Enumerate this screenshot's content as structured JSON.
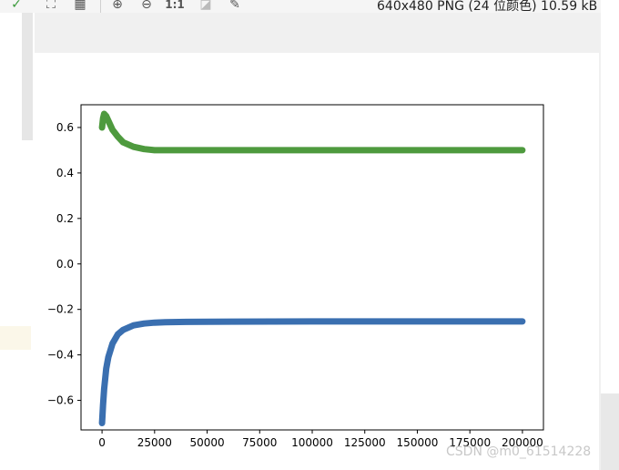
{
  "toolbar": {
    "icons": [
      "check-icon",
      "fit-icon",
      "grid-icon",
      "zoom-in-icon",
      "zoom-out-icon",
      "actual-size-icon",
      "crop-icon",
      "eyedropper-icon"
    ],
    "actual_size_label": "1:1",
    "file_info": "640x480 PNG (24 位颜色) 10.59 kB"
  },
  "watermark": "CSDN @m0_61514228",
  "chart_data": {
    "type": "line",
    "title": "",
    "xlabel": "",
    "ylabel": "",
    "xlim": [
      -10000,
      210000
    ],
    "ylim": [
      -0.73,
      0.7
    ],
    "x_ticks": [
      0,
      25000,
      50000,
      75000,
      100000,
      125000,
      150000,
      175000,
      200000
    ],
    "x_tick_labels": [
      "0",
      "25000",
      "50000",
      "75000",
      "100000",
      "125000",
      "150000",
      "175000",
      "200000"
    ],
    "y_ticks": [
      0.6,
      0.4,
      0.2,
      0.0,
      -0.2,
      -0.4,
      -0.6
    ],
    "y_tick_labels": [
      "0.6",
      "0.4",
      "0.2",
      "0.0",
      "−0.2",
      "−0.4",
      "−0.6"
    ],
    "grid": false,
    "series": [
      {
        "color": "#3a6fb0",
        "x": [
          0,
          500,
          1000,
          2000,
          3000,
          5000,
          7500,
          10000,
          15000,
          20000,
          25000,
          30000,
          40000,
          50000,
          100000,
          150000,
          200000
        ],
        "y": [
          -0.7,
          -0.62,
          -0.55,
          -0.46,
          -0.41,
          -0.35,
          -0.31,
          -0.29,
          -0.27,
          -0.262,
          -0.258,
          -0.256,
          -0.255,
          -0.254,
          -0.253,
          -0.253,
          -0.253
        ]
      },
      {
        "color": "#4e9a3e",
        "x": [
          0,
          500,
          1000,
          2000,
          3000,
          5000,
          7500,
          10000,
          15000,
          20000,
          25000,
          30000,
          40000,
          50000,
          100000,
          150000,
          200000
        ],
        "y": [
          0.6,
          0.64,
          0.66,
          0.65,
          0.63,
          0.59,
          0.56,
          0.535,
          0.515,
          0.505,
          0.5,
          0.5,
          0.5,
          0.5,
          0.5,
          0.5,
          0.5
        ]
      }
    ]
  }
}
